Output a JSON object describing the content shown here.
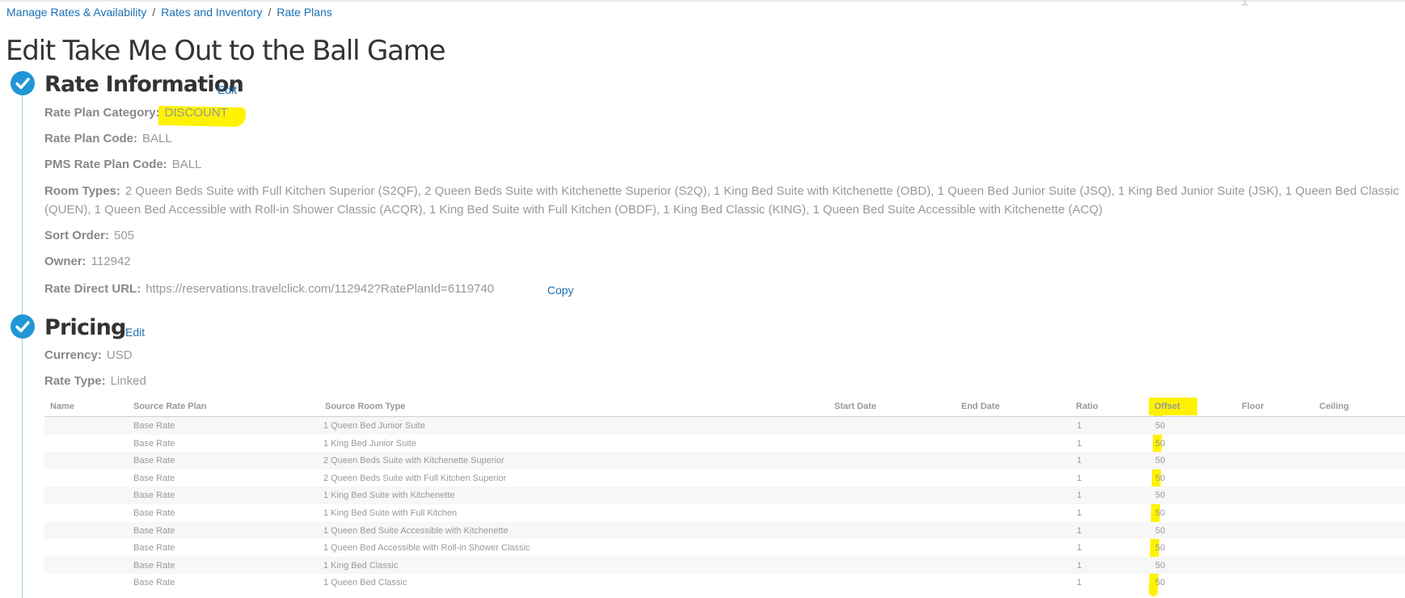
{
  "breadcrumb": {
    "item1": "Manage Rates & Availability",
    "item2": "Rates and Inventory",
    "item3": "Rate Plans",
    "separator": "/"
  },
  "page_title": "Edit Take Me Out to the Ball Game",
  "rate_info": {
    "title": "Rate Information",
    "edit_label": "Edit",
    "category_label": "Rate Plan Category:",
    "category_value": "DISCOUNT",
    "code_label": "Rate Plan Code:",
    "code_value": "BALL",
    "pms_label": "PMS Rate Plan Code:",
    "pms_value": "BALL",
    "room_types_label": "Room Types:",
    "room_types_value": "2 Queen Beds Suite with Full Kitchen Superior (S2QF), 2 Queen Beds Suite with Kitchenette Superior (S2Q), 1 King Bed Suite with Kitchenette (OBD), 1 Queen Bed Junior Suite (JSQ), 1 King Bed Junior Suite (JSK), 1 Queen Bed Classic (QUEN), 1 Queen Bed Accessible with Roll-in Shower Classic (ACQR), 1 King Bed Suite with Full Kitchen (OBDF), 1 King Bed Classic (KING), 1 Queen Bed Suite Accessible with Kitchenette (ACQ)",
    "sort_label": "Sort Order:",
    "sort_value": "505",
    "owner_label": "Owner:",
    "owner_value": "112942",
    "url_label": "Rate Direct URL:",
    "url_value": "https://reservations.travelclick.com/112942?RatePlanId=6119740",
    "copy_label": "Copy"
  },
  "pricing": {
    "title": "Pricing",
    "edit_label": "Edit",
    "currency_label": "Currency:",
    "currency_value": "USD",
    "rate_type_label": "Rate Type:",
    "rate_type_value": "Linked"
  },
  "table": {
    "headers": {
      "name": "Name",
      "source_rate_plan": "Source Rate Plan",
      "source_room_type": "Source Room Type",
      "start_date": "Start Date",
      "end_date": "End Date",
      "ratio": "Ratio",
      "offset": "Offset",
      "floor": "Floor",
      "ceiling": "Ceiling"
    },
    "rows": [
      {
        "name": "",
        "plan": "Base Rate",
        "room": "1 Queen Bed Junior Suite",
        "ratio": "1",
        "offset": "50"
      },
      {
        "name": "",
        "plan": "Base Rate",
        "room": "1 King Bed Junior Suite",
        "ratio": "1",
        "offset": "50"
      },
      {
        "name": "",
        "plan": "Base Rate",
        "room": "2 Queen Beds Suite with Kitchenette Superior",
        "ratio": "1",
        "offset": "50"
      },
      {
        "name": "",
        "plan": "Base Rate",
        "room": "2 Queen Beds Suite with Full Kitchen Superior",
        "ratio": "1",
        "offset": "50"
      },
      {
        "name": "",
        "plan": "Base Rate",
        "room": "1 King Bed Suite with Kitchenette",
        "ratio": "1",
        "offset": "50"
      },
      {
        "name": "",
        "plan": "Base Rate",
        "room": "1 King Bed Suite with Full Kitchen",
        "ratio": "1",
        "offset": "50"
      },
      {
        "name": "",
        "plan": "Base Rate",
        "room": "1 Queen Bed Suite Accessible with Kitchenette",
        "ratio": "1",
        "offset": "50"
      },
      {
        "name": "",
        "plan": "Base Rate",
        "room": "1 Queen Bed Accessible with Roll-in Shower Classic",
        "ratio": "1",
        "offset": "50"
      },
      {
        "name": "",
        "plan": "Base Rate",
        "room": "1 King Bed Classic",
        "ratio": "1",
        "offset": "50"
      },
      {
        "name": "",
        "plan": "Base Rate",
        "room": "1 Queen Bed Classic",
        "ratio": "1",
        "offset": "50"
      }
    ]
  },
  "colors": {
    "link": "#1a6fb3",
    "check": "#2196d6",
    "highlight": "#fff200",
    "timeline": "#9fd2e5"
  }
}
